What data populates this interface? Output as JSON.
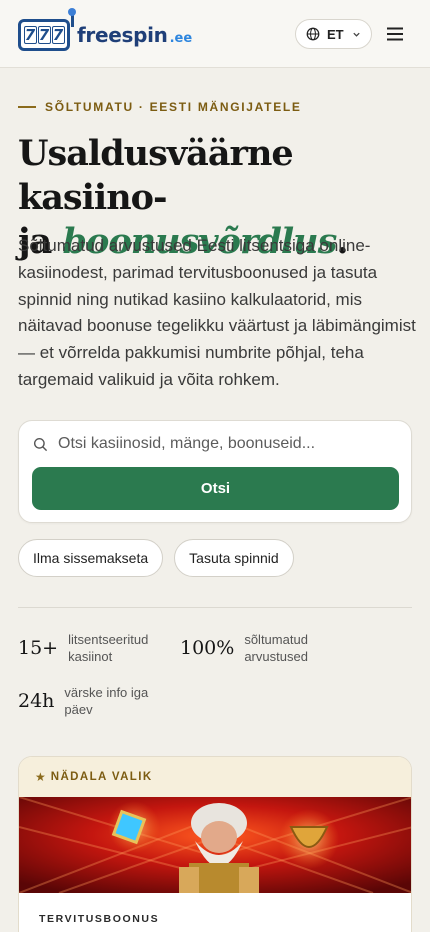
{
  "header": {
    "logo": {
      "slot_digits": [
        "7",
        "7",
        "7"
      ],
      "name": "freespin",
      "tld": ".ee"
    },
    "language": {
      "code": "ET",
      "icon": "globe-icon"
    },
    "menu_icon": "hamburger-menu-icon"
  },
  "hero": {
    "eyebrow": "SÕLTUMATU · EESTI MÄNGIJATELE",
    "title_line1": "Usaldusväärne kasiino-",
    "title_line2_prefix": "ja",
    "title_accent": "boonusvõrdlus",
    "title_suffix": ".",
    "description": "Sõltumatud arvustused Eesti litsentsiga online-kasiinodest, parimad tervitusboonused ja tasuta spinnid ning nutikad kasiino kalkulaatorid, mis näitavad boonuse tegelikku väärtust ja läbimängimist — et võrrelda pakkumisi numbrite põhjal, teha targemaid valikuid ja võita rohkem."
  },
  "search": {
    "placeholder": "Otsi kasiinosid, mänge, boonuseid...",
    "value": "",
    "button_label": "Otsi"
  },
  "chips": [
    "Ilma sissemakseta",
    "Tasuta spinnid"
  ],
  "stats": [
    {
      "value": "15+",
      "label": "litsentseeritud kasiinot"
    },
    {
      "value": "100%",
      "label": "sõltumatud arvustused"
    },
    {
      "value": "24h",
      "label": "värske info iga päev"
    }
  ],
  "featured": {
    "badge": "NÄDALA VALIK",
    "badge_icon": "star-icon",
    "type": "TERVITUSBOONUS"
  },
  "colors": {
    "accent_green": "#2b7a4f",
    "gold": "#7c5c12",
    "logo_blue": "#1f4e8c",
    "background": "#f2f0ea"
  }
}
